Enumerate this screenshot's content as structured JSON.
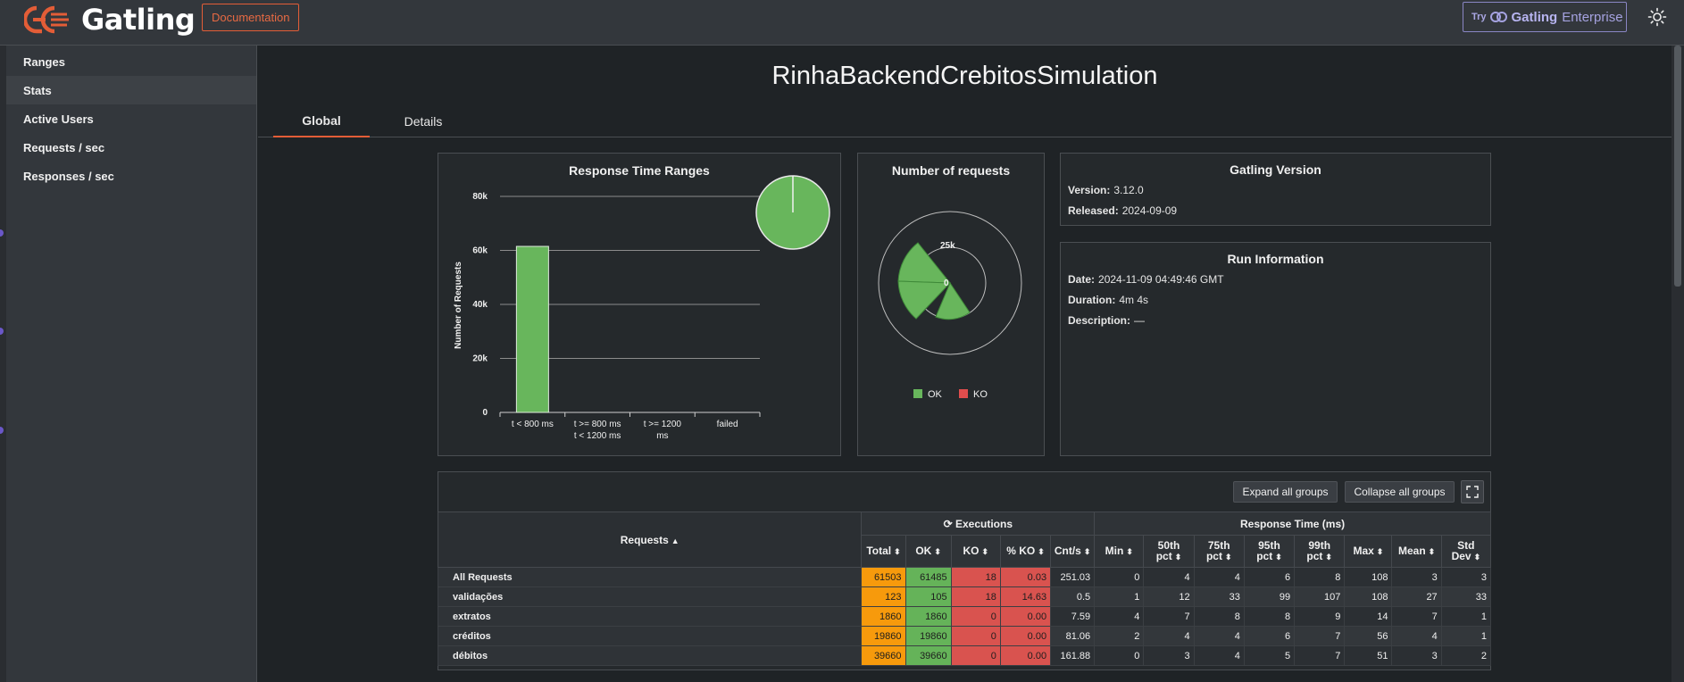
{
  "header": {
    "brand": "Gatling",
    "documentation": "Documentation",
    "enterprise_try": "Try",
    "enterprise_brand": "Gatling",
    "enterprise_label": "Enterprise"
  },
  "sidebar": {
    "items": [
      {
        "label": "Ranges"
      },
      {
        "label": "Stats"
      },
      {
        "label": "Active Users"
      },
      {
        "label": "Requests / sec"
      },
      {
        "label": "Responses / sec"
      }
    ]
  },
  "main": {
    "title": "RinhaBackendCrebitosSimulation",
    "tabs": [
      {
        "label": "Global"
      },
      {
        "label": "Details"
      }
    ]
  },
  "ranges_card": {
    "title": "Response Time Ranges",
    "ylabel": "Number of Requests"
  },
  "requests_card": {
    "title": "Number of requests",
    "legend_ok": "OK",
    "legend_ko": "KO",
    "ring_outer": "25k",
    "ring_inner": "0"
  },
  "version_card": {
    "title": "Gatling Version",
    "version_label": "Version:",
    "version_value": "3.12.0",
    "released_label": "Released:",
    "released_value": "2024-09-09"
  },
  "run_card": {
    "title": "Run Information",
    "date_label": "Date:",
    "date_value": "2024-11-09 04:49:46 GMT",
    "duration_label": "Duration:",
    "duration_value": "4m 4s",
    "description_label": "Description:",
    "description_value": "—"
  },
  "stats_table": {
    "expand": "Expand all groups",
    "collapse": "Collapse all groups",
    "requests_header": "Requests",
    "executions_header": "Executions",
    "response_time_header": "Response Time (ms)",
    "columns": [
      "Total",
      "OK",
      "KO",
      "% KO",
      "Cnt/s",
      "Min",
      "50th pct",
      "75th pct",
      "95th pct",
      "99th pct",
      "Max",
      "Mean",
      "Std Dev"
    ],
    "rows": [
      {
        "name": "All Requests",
        "total": "61503",
        "ok": "61485",
        "ko": "18",
        "pko": "0.03",
        "cnt": "251.03",
        "min": "0",
        "p50": "4",
        "p75": "4",
        "p95": "6",
        "p99": "8",
        "max": "108",
        "mean": "3",
        "std": "3"
      },
      {
        "name": "validações",
        "total": "123",
        "ok": "105",
        "ko": "18",
        "pko": "14.63",
        "cnt": "0.5",
        "min": "1",
        "p50": "12",
        "p75": "33",
        "p95": "99",
        "p99": "107",
        "max": "108",
        "mean": "27",
        "std": "33"
      },
      {
        "name": "extratos",
        "total": "1860",
        "ok": "1860",
        "ko": "0",
        "pko": "0.00",
        "cnt": "7.59",
        "min": "4",
        "p50": "7",
        "p75": "8",
        "p95": "8",
        "p99": "9",
        "max": "14",
        "mean": "7",
        "std": "1"
      },
      {
        "name": "créditos",
        "total": "19860",
        "ok": "19860",
        "ko": "0",
        "pko": "0.00",
        "cnt": "81.06",
        "min": "2",
        "p50": "4",
        "p75": "4",
        "p95": "6",
        "p99": "7",
        "max": "56",
        "mean": "4",
        "std": "1"
      },
      {
        "name": "débitos",
        "total": "39660",
        "ok": "39660",
        "ko": "0",
        "pko": "0.00",
        "cnt": "161.88",
        "min": "0",
        "p50": "3",
        "p75": "4",
        "p95": "5",
        "p99": "7",
        "max": "51",
        "mean": "3",
        "std": "2"
      }
    ]
  },
  "chart_data": [
    {
      "type": "bar",
      "title": "Response Time Ranges",
      "ylabel": "Number of Requests",
      "categories": [
        "t < 800 ms",
        "t >= 800 ms\nt < 1200 ms",
        "t >= 1200\nms",
        "failed"
      ],
      "values": [
        61485,
        0,
        0,
        18
      ],
      "ylim": [
        0,
        80000
      ],
      "yticks": [
        "0",
        "20k",
        "40k",
        "60k",
        "80k"
      ],
      "grid": true,
      "color": "#68b65c",
      "inset_pie": {
        "ok_fraction": 0.9997
      }
    },
    {
      "type": "pie",
      "title": "Number of requests",
      "style": "polar-area",
      "series": [
        {
          "name": "OK",
          "color": "#68b65c"
        },
        {
          "name": "KO",
          "color": "#e04d4d"
        }
      ],
      "rings": [
        "0",
        "25k"
      ]
    }
  ],
  "colors": {
    "accent": "#e35d37",
    "ok": "#68b65c",
    "ko": "#d9534f",
    "total": "#f79a0c",
    "enterprise": "#9a97d6"
  }
}
